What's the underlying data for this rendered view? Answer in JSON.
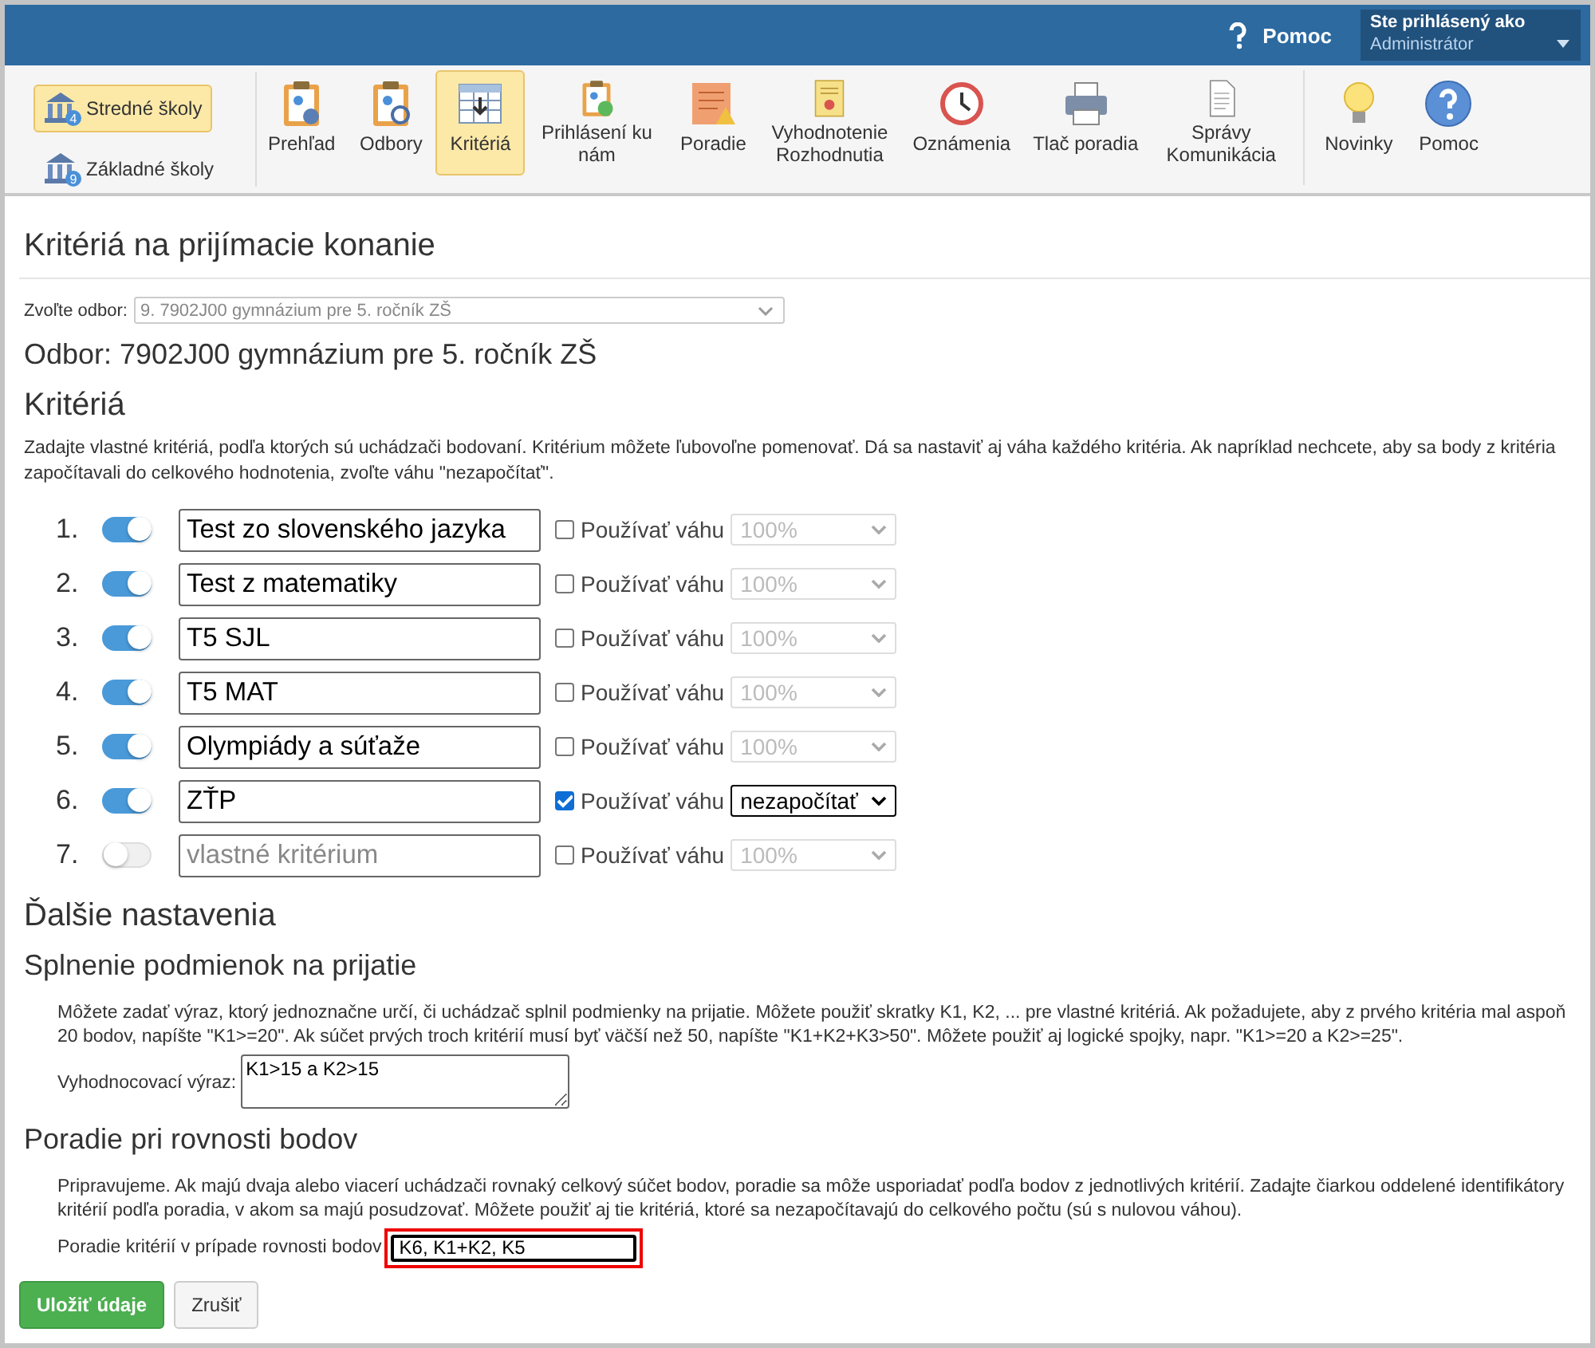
{
  "topbar": {
    "help": "Pomoc",
    "user_label": "Ste prihlásený ako",
    "user": "Administrátor"
  },
  "schools": [
    {
      "label": "Stredné školy",
      "badge": "4",
      "selected": true
    },
    {
      "label": "Základné školy",
      "badge": "9",
      "selected": false
    }
  ],
  "toolbar": [
    {
      "label": "Prehľad",
      "selected": false
    },
    {
      "label": "Odbory",
      "selected": false
    },
    {
      "label": "Kritériá",
      "selected": true
    },
    {
      "label": "Prihlásení ku nám",
      "selected": false
    },
    {
      "label": "Poradie",
      "selected": false
    },
    {
      "label": "Vyhodnotenie Rozhodnutia",
      "selected": false
    },
    {
      "label": "Oznámenia",
      "selected": false
    },
    {
      "label": "Tlač poradia",
      "selected": false
    },
    {
      "label": "Správy Komunikácia",
      "selected": false
    }
  ],
  "toolbar_extra": [
    {
      "label": "Novinky"
    },
    {
      "label": "Pomoc"
    }
  ],
  "page_title": "Kritériá na prijímacie konanie",
  "odbor_select": {
    "label": "Zvoľte odbor:",
    "value": "9. 7902J00 gymnázium pre 5. ročník ZŠ"
  },
  "odbor_heading": "Odbor: 7902J00 gymnázium pre 5. ročník ZŠ",
  "criteria_heading": "Kritériá",
  "criteria_intro": "Zadajte vlastné kritériá, podľa ktorých sú uchádzači bodovaní. Kritérium môžete ľubovoľne pomenovať. Dá sa nastaviť aj váha každého kritéria. Ak napríklad nechcete, aby sa body z kritéria započítavali do celkového hodnotenia, zvoľte váhu \"nezapočítať\".",
  "criteria": [
    {
      "number": "1.",
      "on": true,
      "value": "Test zo slovenského jazyka",
      "weight_label": "Používať váhu",
      "weight_checked": false,
      "weight": "100%"
    },
    {
      "number": "2.",
      "on": true,
      "value": "Test z matematiky",
      "weight_label": "Používať váhu",
      "weight_checked": false,
      "weight": "100%"
    },
    {
      "number": "3.",
      "on": true,
      "value": "T5 SJL",
      "weight_label": "Používať váhu",
      "weight_checked": false,
      "weight": "100%"
    },
    {
      "number": "4.",
      "on": true,
      "value": "T5 MAT",
      "weight_label": "Používať váhu",
      "weight_checked": false,
      "weight": "100%"
    },
    {
      "number": "5.",
      "on": true,
      "value": "Olympiády a súťaže",
      "weight_label": "Používať váhu",
      "weight_checked": false,
      "weight": "100%"
    },
    {
      "number": "6.",
      "on": true,
      "value": "ZŤP",
      "weight_label": "Používať váhu",
      "weight_checked": true,
      "weight": "nezapočítať"
    },
    {
      "number": "7.",
      "on": false,
      "placeholder": "vlastné kritérium",
      "weight_label": "Používať váhu",
      "weight_checked": false,
      "weight": "100%"
    }
  ],
  "more_heading": "Ďalšie nastavenia",
  "condition": {
    "heading": "Splnenie podmienok na prijatie",
    "text": "Môžete zadať výraz, ktorý jednoznačne určí, či uchádzač splnil podmienky na prijatie. Môžete použiť skratky K1, K2, ... pre vlastné kritériá. Ak požadujete, aby z prvého kritéria mal aspoň 20 bodov, napíšte \"K1>=20\". Ak súčet prvých troch kritérií musí byť väčší než 50, napíšte \"K1+K2+K3>50\". Môžete použiť aj logické spojky, napr. \"K1>=20 a K2>=25\".",
    "field_label": "Vyhodnocovací výraz:",
    "value": "K1>15 a K2>15"
  },
  "tie": {
    "heading": "Poradie pri rovnosti bodov",
    "text": "Pripravujeme. Ak majú dvaja alebo viacerí uchádzači rovnaký celkový súčet bodov, poradie sa môže usporiadať podľa bodov z jednotlivých kritérií. Zadajte čiarkou oddelené identifikátory kritérií podľa poradia, v akom sa majú posudzovať. Môžete použiť aj tie kritériá, ktoré sa nezapočítavajú do celkového počtu (sú s nulovou váhou).",
    "field_label": "Poradie kritérií v prípade rovnosti bodov",
    "value": "K6, K1+K2, K5",
    "highlighted": true
  },
  "buttons": [
    {
      "label": "Uložiť údaje",
      "kind": "primary"
    },
    {
      "label": "Zrušiť",
      "kind": "default"
    }
  ]
}
